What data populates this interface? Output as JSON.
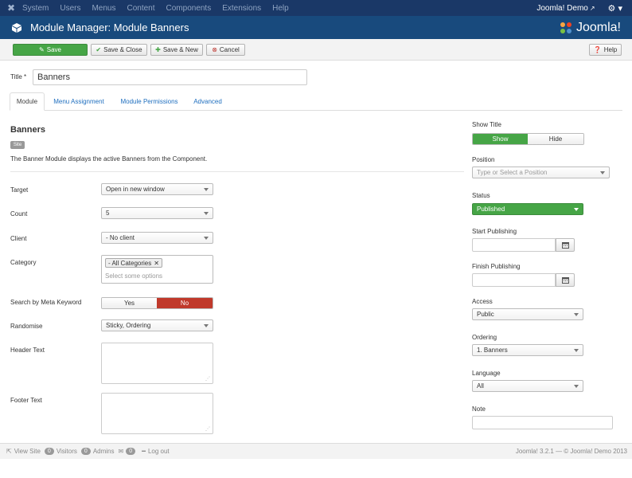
{
  "topnav": {
    "menu": [
      "System",
      "Users",
      "Menus",
      "Content",
      "Components",
      "Extensions",
      "Help"
    ],
    "site_name": "Joomla! Demo"
  },
  "header": {
    "title": "Module Manager: Module Banners",
    "brand": "Joomla!"
  },
  "toolbar": {
    "save": "Save",
    "save_close": "Save & Close",
    "save_new": "Save & New",
    "cancel": "Cancel",
    "help": "Help"
  },
  "form": {
    "title_label": "Title *",
    "title_value": "Banners"
  },
  "tabs": [
    "Module",
    "Menu Assignment",
    "Module Permissions",
    "Advanced"
  ],
  "module": {
    "name": "Banners",
    "badge": "Site",
    "description": "The Banner Module displays the active Banners from the Component."
  },
  "fields": {
    "target": {
      "label": "Target",
      "value": "Open in new window"
    },
    "count": {
      "label": "Count",
      "value": "5"
    },
    "client": {
      "label": "Client",
      "value": "- No client"
    },
    "category": {
      "label": "Category",
      "chip": "- All Categories",
      "placeholder": "Select some options"
    },
    "meta": {
      "label": "Search by Meta Keyword",
      "yes": "Yes",
      "no": "No"
    },
    "randomise": {
      "label": "Randomise",
      "value": "Sticky, Ordering"
    },
    "header_text": {
      "label": "Header Text"
    },
    "footer_text": {
      "label": "Footer Text"
    }
  },
  "right": {
    "show_title": {
      "label": "Show Title",
      "show": "Show",
      "hide": "Hide"
    },
    "position": {
      "label": "Position",
      "placeholder": "Type or Select a Position"
    },
    "status": {
      "label": "Status",
      "value": "Published"
    },
    "start_publishing": {
      "label": "Start Publishing"
    },
    "finish_publishing": {
      "label": "Finish Publishing"
    },
    "access": {
      "label": "Access",
      "value": "Public"
    },
    "ordering": {
      "label": "Ordering",
      "value": "1. Banners"
    },
    "language": {
      "label": "Language",
      "value": "All"
    },
    "note": {
      "label": "Note"
    }
  },
  "footer": {
    "view_site": "View Site",
    "visitors_count": "0",
    "visitors": "Visitors",
    "admins_count": "0",
    "admins": "Admins",
    "messages_count": "0",
    "logout": "Log out",
    "copyright": "Joomla! 3.2.1 — © Joomla! Demo 2013"
  },
  "colors": {
    "topnav": "#1a3867",
    "header": "#184a7d",
    "success": "#46a546",
    "danger": "#c0392b",
    "link": "#1f6fbf"
  }
}
